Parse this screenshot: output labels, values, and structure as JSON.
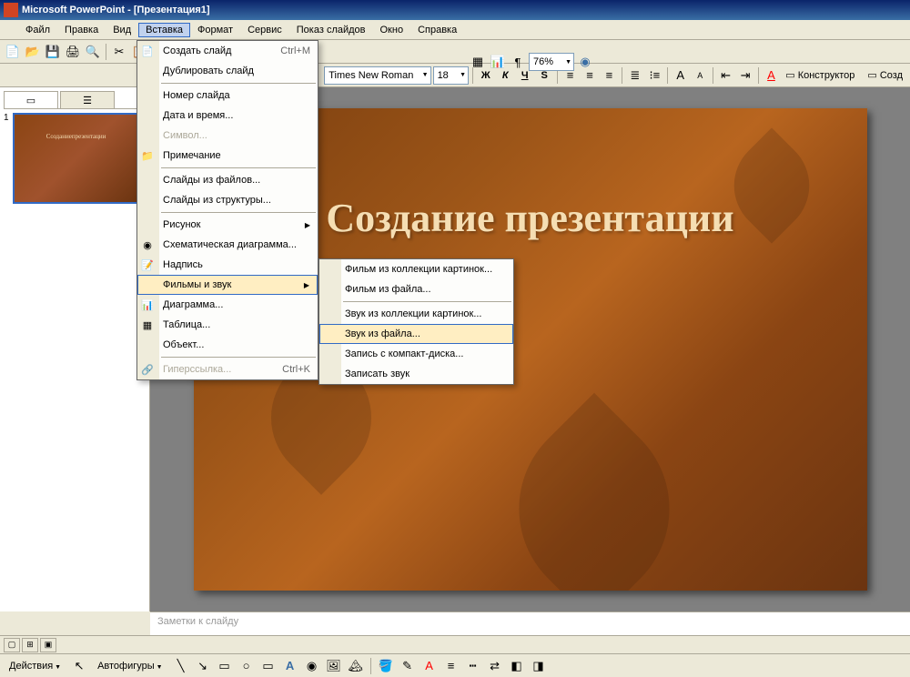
{
  "titlebar": {
    "app": "Microsoft PowerPoint",
    "doc": "[Презентация1]"
  },
  "menubar": [
    "Файл",
    "Правка",
    "Вид",
    "Вставка",
    "Формат",
    "Сервис",
    "Показ слайдов",
    "Окно",
    "Справка"
  ],
  "menubar_active_index": 3,
  "toolbar2": {
    "font": "Times New Roman",
    "size": "18",
    "zoom": "76%",
    "bold": "Ж",
    "italic": "К",
    "underline": "Ч",
    "shadow": "S",
    "design_label": "Конструктор",
    "new_slide_label": "Созд"
  },
  "insert_menu": [
    {
      "label": "Создать слайд",
      "shortcut": "Ctrl+M",
      "icon": "📄"
    },
    {
      "label": "Дублировать слайд"
    },
    {
      "sep": true
    },
    {
      "label": "Номер слайда"
    },
    {
      "label": "Дата и время..."
    },
    {
      "label": "Символ...",
      "disabled": true
    },
    {
      "label": "Примечание",
      "icon": "📁"
    },
    {
      "sep": true
    },
    {
      "label": "Слайды из файлов..."
    },
    {
      "label": "Слайды из структуры..."
    },
    {
      "sep": true
    },
    {
      "label": "Рисунок",
      "submenu": true
    },
    {
      "label": "Схематическая диаграмма...",
      "icon": "◉"
    },
    {
      "label": "Надпись",
      "icon": "📝"
    },
    {
      "label": "Фильмы и звук",
      "submenu": true,
      "highlighted": true
    },
    {
      "label": "Диаграмма...",
      "icon": "📊"
    },
    {
      "label": "Таблица...",
      "icon": "▦"
    },
    {
      "label": "Объект..."
    },
    {
      "sep": true
    },
    {
      "label": "Гиперссылка...",
      "shortcut": "Ctrl+K",
      "disabled": true,
      "icon": "🔗"
    }
  ],
  "sound_submenu": [
    {
      "label": "Фильм из коллекции картинок..."
    },
    {
      "label": "Фильм из файла..."
    },
    {
      "sep": true
    },
    {
      "label": "Звук из коллекции картинок..."
    },
    {
      "label": "Звук из файла...",
      "highlighted": true
    },
    {
      "label": "Запись с компакт-диска..."
    },
    {
      "label": "Записать звук"
    }
  ],
  "slide": {
    "number": "1",
    "title": "Создание презентации",
    "thumb_title": "Созданиепрезентации"
  },
  "notes_placeholder": "Заметки к слайду",
  "drawbar": {
    "actions": "Действия",
    "autoshapes": "Автофигуры"
  }
}
